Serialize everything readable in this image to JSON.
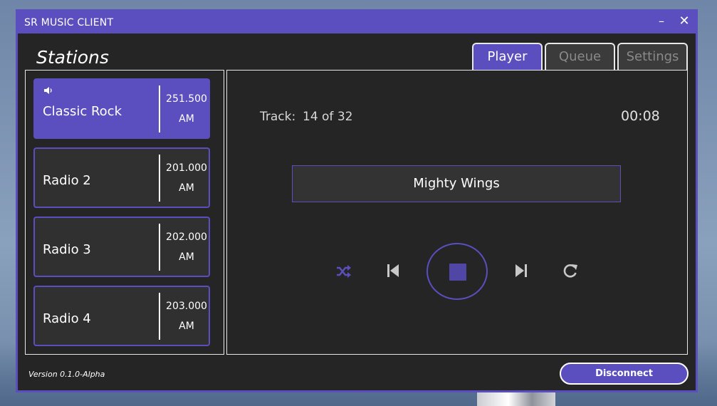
{
  "window": {
    "title": "SR MUSIC CLIENT",
    "minimize_glyph": "–",
    "close_glyph": "✕"
  },
  "stations": {
    "heading": "Stations",
    "items": [
      {
        "name": "Classic Rock",
        "frequency": "251.500",
        "band": "AM",
        "active": true,
        "icon": "speaker-icon"
      },
      {
        "name": "Radio 2",
        "frequency": "201.000",
        "band": "AM",
        "active": false
      },
      {
        "name": "Radio 3",
        "frequency": "202.000",
        "band": "AM",
        "active": false
      },
      {
        "name": "Radio 4",
        "frequency": "203.000",
        "band": "AM",
        "active": false
      }
    ]
  },
  "tabs": [
    {
      "label": "Player",
      "active": true
    },
    {
      "label": "Queue",
      "active": false
    },
    {
      "label": "Settings",
      "active": false
    }
  ],
  "player": {
    "track_label": "Track:",
    "track_value": "14 of 32",
    "elapsed": "00:08",
    "song_title": "Mighty Wings",
    "controls": [
      "shuffle-icon",
      "previous-icon",
      "stop-icon",
      "next-icon",
      "repeat-icon"
    ]
  },
  "footer": {
    "version": "Version 0.1.0-Alpha",
    "disconnect_label": "Disconnect"
  },
  "colors": {
    "accent": "#5b4fbf",
    "background": "#252526",
    "card": "#303030"
  }
}
